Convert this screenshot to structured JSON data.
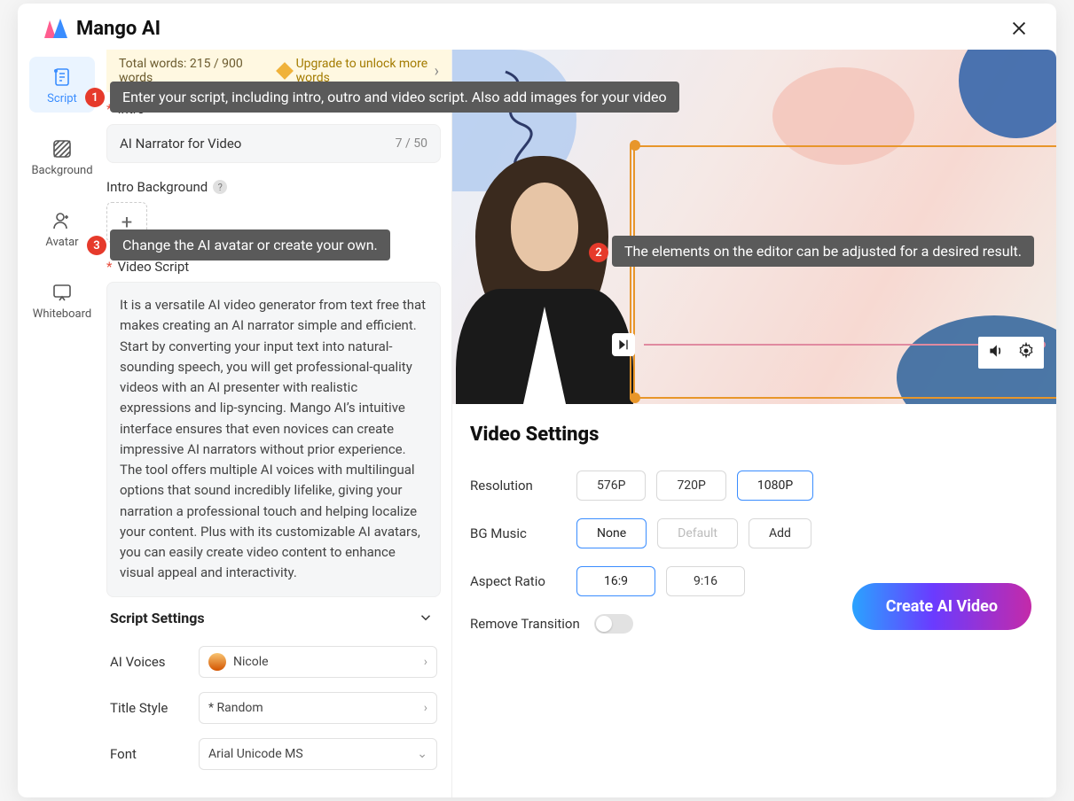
{
  "app": {
    "name": "Mango AI"
  },
  "sidebar": {
    "items": [
      {
        "label": "Script"
      },
      {
        "label": "Background"
      },
      {
        "label": "Avatar"
      },
      {
        "label": "Whiteboard"
      }
    ]
  },
  "banner": {
    "total_words": "Total words: 215 / 900 words",
    "upgrade": "Upgrade to unlock more words"
  },
  "intro": {
    "label": "Intro",
    "value": "AI Narrator for Video",
    "count": "7 / 50",
    "bg_label": "Intro Background"
  },
  "video_script": {
    "label": "Video Script",
    "text": "It is a versatile AI video generator from text free that makes creating an AI narrator simple and efficient. Start by converting your input text into natural-sounding speech, you will get professional-quality videos with an AI presenter with realistic expressions and lip-syncing. Mango AI’s intuitive interface ensures that even novices can create impressive AI narrators without prior experience. The tool offers multiple AI voices with multilingual options that sound incredibly lifelike, giving your narration a professional touch and helping localize your content. Plus with its customizable AI avatars, you can easily create video content to enhance visual appeal and interactivity."
  },
  "script_settings": {
    "title": "Script Settings",
    "voices_label": "AI Voices",
    "voices_value": "Nicole",
    "title_style_label": "Title Style",
    "title_style_value": "* Random",
    "font_label": "Font",
    "font_value": "Arial Unicode MS"
  },
  "video_settings": {
    "title": "Video Settings",
    "resolution_label": "Resolution",
    "resolution_options": [
      "576P",
      "720P",
      "1080P"
    ],
    "bg_music_label": "BG Music",
    "bg_music_options": [
      "None",
      "Default",
      "Add"
    ],
    "aspect_ratio_label": "Aspect Ratio",
    "aspect_ratio_options": [
      "16:9",
      "9:16"
    ],
    "remove_transition_label": "Remove Transition"
  },
  "cta": {
    "label": "Create AI Video"
  },
  "tips": {
    "1": "Enter your script, including intro, outro and video script. Also add images for your video",
    "2": "The elements on the editor can be adjusted for a desired result.",
    "3": "Change the AI avatar or create your own."
  }
}
